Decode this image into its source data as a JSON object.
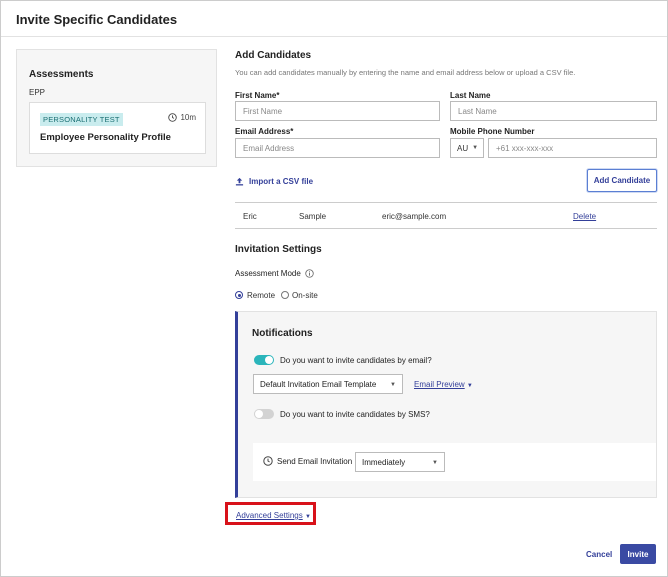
{
  "header": {
    "title": "Invite Specific Candidates"
  },
  "assessments": {
    "title": "Assessments",
    "group": "EPP",
    "card": {
      "badge": "PERSONALITY TEST",
      "duration": "10m",
      "name": "Employee Personality Profile"
    }
  },
  "add_candidates": {
    "title": "Add Candidates",
    "hint": "You can add candidates manually by entering the name and email address below or upload a CSV file.",
    "first_name": {
      "label": "First Name*",
      "placeholder": "First Name"
    },
    "last_name": {
      "label": "Last Name",
      "placeholder": "Last Name"
    },
    "email": {
      "label": "Email Address*",
      "placeholder": "Email Address"
    },
    "phone": {
      "label": "Mobile Phone Number",
      "country": "AU",
      "placeholder": "+61 xxx-xxx-xxx"
    },
    "import_label": "Import a CSV file",
    "add_button": "Add Candidate",
    "candidates": [
      {
        "first": "Eric",
        "last": "Sample",
        "email": "eric@sample.com",
        "action": "Delete"
      }
    ]
  },
  "invitation_settings": {
    "title": "Invitation Settings",
    "mode_label": "Assessment Mode",
    "modes": [
      "Remote",
      "On-site"
    ],
    "selected_mode": "Remote"
  },
  "notifications": {
    "title": "Notifications",
    "email_toggle_label": "Do you want to invite candidates by email?",
    "email_enabled": true,
    "template_value": "Default Invitation Email Template",
    "email_preview": "Email Preview",
    "sms_toggle_label": "Do you want to invite candidates by SMS?",
    "sms_enabled": false,
    "send_label": "Send Email Invitation",
    "send_value": "Immediately"
  },
  "advanced_settings": "Advanced Settings",
  "footer": {
    "cancel": "Cancel",
    "invite": "Invite"
  },
  "colors": {
    "primary": "#3a4aa3",
    "toggle_on": "#2bb5bb",
    "badge_bg": "#c9ecee",
    "highlight": "#d8121a"
  }
}
